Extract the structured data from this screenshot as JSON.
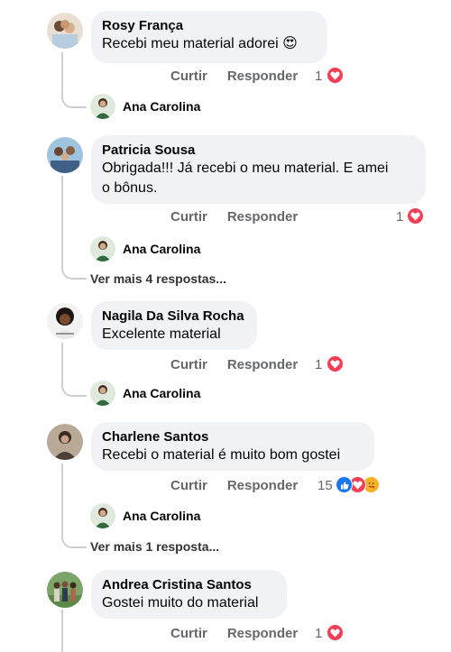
{
  "actions": {
    "like": "Curtir",
    "reply": "Responder"
  },
  "colors": {
    "heart": "#f33e58",
    "like_blue": "#1877f2",
    "bubble": "#f0f2f5"
  },
  "comments": [
    {
      "name": "Rosy França",
      "text": "Recebi meu material adorei",
      "emoji": "😍",
      "count": "1",
      "reactions": [
        "heart"
      ]
    },
    {
      "name": "Patricia Sousa",
      "text_line1": "Obrigada!!! Já recebi o meu material. E amei",
      "text_line2": "o bônus.",
      "count": "1",
      "reactions": [
        "heart"
      ]
    },
    {
      "name": "Nagila Da Silva Rocha",
      "text": "Excelente material",
      "count": "1",
      "reactions": [
        "heart"
      ]
    },
    {
      "name": "Charlene Santos",
      "text": "Recebi o material é muito bom gostei",
      "count": "15",
      "reactions": [
        "like",
        "heart",
        "care"
      ]
    },
    {
      "name": "Andrea Cristina Santos",
      "text": "Gostei muito do material",
      "count": "1",
      "reactions": [
        "heart"
      ]
    }
  ],
  "replies": [
    {
      "name": "Ana Carolina"
    },
    {
      "name": "Ana Carolina"
    },
    {
      "name": "Ana Carolina"
    },
    {
      "name": "Ana Carolina"
    }
  ],
  "more_replies": [
    "Ver mais 4 respostas...",
    "Ver mais 1 resposta..."
  ]
}
